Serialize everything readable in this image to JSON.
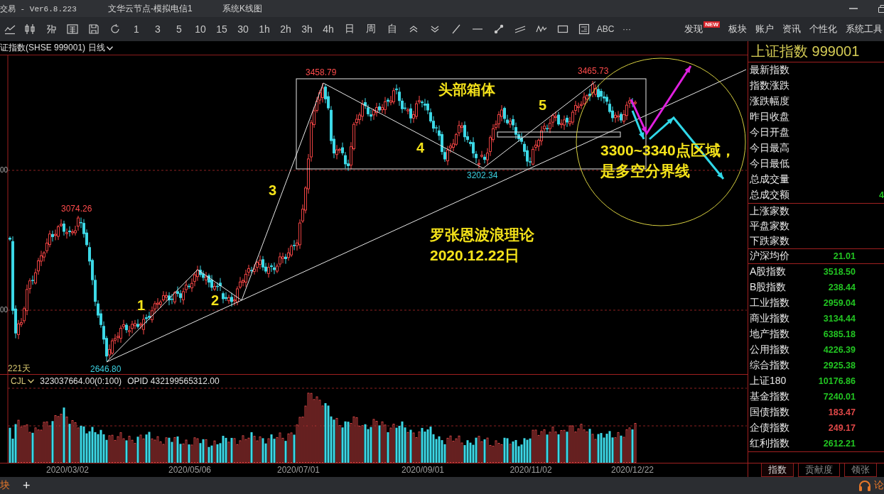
{
  "window": {
    "title": "交易  -  Ver6.8.223",
    "server": "文华云节点-模拟电信1",
    "view": "系统K线图"
  },
  "toolbar": {
    "periods": [
      "1",
      "3",
      "5",
      "10",
      "15",
      "30",
      "1h",
      "2h",
      "3h",
      "4h",
      "日",
      "周",
      "自"
    ],
    "text_tools": [
      "ABC",
      "···"
    ],
    "menu": [
      {
        "label": "发现",
        "badge": "NEW"
      },
      {
        "label": "板块"
      },
      {
        "label": "账户"
      },
      {
        "label": "资讯"
      },
      {
        "label": "个性化"
      },
      {
        "label": "系统工具"
      }
    ]
  },
  "chart": {
    "symbol": "证指数(SHSE 999001)",
    "period": "日线",
    "y_axis": [
      "00",
      "00"
    ],
    "bar_count": "221天",
    "price_labels": [
      {
        "text": "3458.79",
        "kind": "high"
      },
      {
        "text": "3465.73",
        "kind": "high"
      },
      {
        "text": "3074.26",
        "kind": "high"
      },
      {
        "text": "3202.34",
        "kind": "low"
      },
      {
        "text": "2646.80",
        "kind": "low"
      }
    ],
    "wave_labels": [
      "1",
      "2",
      "3",
      "4",
      "5"
    ],
    "box_label": "头部箱体",
    "zone_note": [
      "3300~3340点区域，",
      "是多空分界线"
    ],
    "theory_note": [
      "罗张恩波浪理论",
      "2020.12.22日"
    ]
  },
  "volume": {
    "indicator": "CJL",
    "reading": "323037664.00(0:100)",
    "opid": "OPID 432199565312.00"
  },
  "dates": [
    "2020/03/02",
    "2020/05/06",
    "2020/07/01",
    "2020/09/01",
    "2020/11/02",
    "2020/12/22"
  ],
  "quote_panel": {
    "title": "上证指数 999001",
    "groups": [
      {
        "kind": "stats",
        "rows": [
          {
            "label": "最新指数"
          },
          {
            "label": "指数涨跌"
          },
          {
            "label": "涨跌幅度"
          },
          {
            "label": "昨日收盘"
          },
          {
            "label": "今日开盘"
          },
          {
            "label": "今日最高"
          },
          {
            "label": "今日最低"
          },
          {
            "label": "总成交量"
          },
          {
            "label": "总成交额",
            "value": "4",
            "color": "#22c522"
          }
        ]
      },
      {
        "kind": "breadth",
        "rows": [
          {
            "label": "上涨家数"
          },
          {
            "label": "平盘家数"
          },
          {
            "label": "下跌家数"
          }
        ]
      },
      {
        "kind": "average",
        "rows": [
          {
            "label": "沪深均价",
            "value": "21.01",
            "color": "#22c522"
          }
        ]
      },
      {
        "kind": "indices",
        "rows": [
          {
            "label": "A股指数",
            "value": "3518.50",
            "color": "#22c522"
          },
          {
            "label": "B股指数",
            "value": "238.44",
            "color": "#22c522"
          },
          {
            "label": "工业指数",
            "value": "2959.04",
            "color": "#22c522"
          },
          {
            "label": "商业指数",
            "value": "3134.44",
            "color": "#22c522"
          },
          {
            "label": "地产指数",
            "value": "6385.18",
            "color": "#22c522"
          },
          {
            "label": "公用指数",
            "value": "4226.39",
            "color": "#22c522"
          },
          {
            "label": "综合指数",
            "value": "2925.38",
            "color": "#22c522"
          },
          {
            "label": "上证180",
            "value": "10176.86",
            "color": "#22c522"
          },
          {
            "label": "基金指数",
            "value": "7240.01",
            "color": "#22c522"
          },
          {
            "label": "国债指数",
            "value": "183.47",
            "color": "#e04848"
          },
          {
            "label": "企债指数",
            "value": "249.17",
            "color": "#e04848"
          },
          {
            "label": "红利指数",
            "value": "2612.21",
            "color": "#22c522"
          }
        ]
      }
    ],
    "tabs": [
      {
        "label": "指数",
        "selected": true
      },
      {
        "label": "贡献度",
        "selected": false
      },
      {
        "label": "领张",
        "selected": false
      }
    ]
  },
  "status_bar": {
    "left": "块",
    "add": "+",
    "right": "论"
  }
}
